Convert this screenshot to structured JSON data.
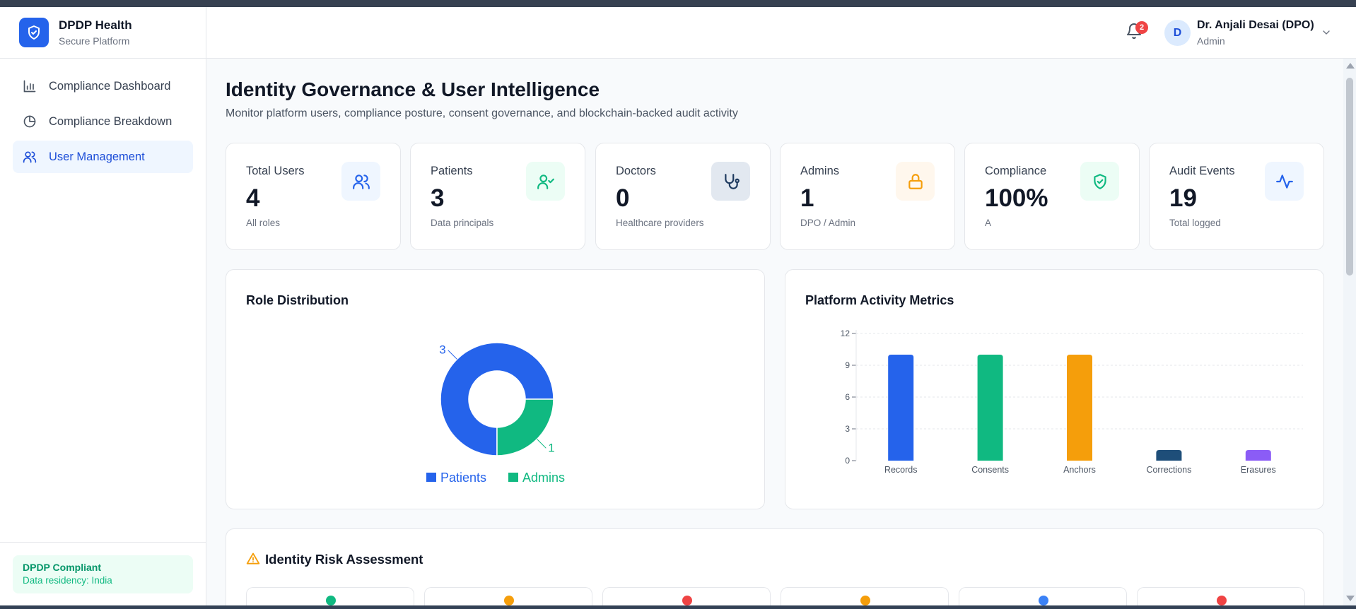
{
  "brand": {
    "title": "DPDP Health",
    "subtitle": "Secure Platform"
  },
  "sidebar": {
    "items": [
      {
        "label": "Compliance Dashboard",
        "icon": "bar-chart-icon",
        "active": false
      },
      {
        "label": "Compliance Breakdown",
        "icon": "pie-chart-icon",
        "active": false
      },
      {
        "label": "User Management",
        "icon": "users-icon",
        "active": true
      }
    ],
    "footer": {
      "title": "DPDP Compliant",
      "subtitle": "Data residency: India"
    }
  },
  "header": {
    "notification_count": "2",
    "avatar_initial": "D",
    "user_name": "Dr. Anjali Desai (DPO)",
    "user_role": "Admin"
  },
  "page": {
    "title": "Identity Governance & User Intelligence",
    "subtitle": "Monitor platform users, compliance posture, consent governance, and blockchain-backed audit activity"
  },
  "stats": [
    {
      "label": "Total Users",
      "value": "4",
      "note": "All roles",
      "icon": "users-icon",
      "color": "#2563eb",
      "bg": "#eff6ff"
    },
    {
      "label": "Patients",
      "value": "3",
      "note": "Data principals",
      "icon": "user-check-icon",
      "color": "#10b981",
      "bg": "#ecfdf5"
    },
    {
      "label": "Doctors",
      "value": "0",
      "note": "Healthcare providers",
      "icon": "stethoscope-icon",
      "color": "#1e3a5f",
      "bg": "#e2e8f0"
    },
    {
      "label": "Admins",
      "value": "1",
      "note": "DPO / Admin",
      "icon": "lock-icon",
      "color": "#f59e0b",
      "bg": "#fff7ed"
    },
    {
      "label": "Compliance",
      "value": "100%",
      "note": "A",
      "icon": "shield-check-icon",
      "color": "#10b981",
      "bg": "#ecfdf5"
    },
    {
      "label": "Audit Events",
      "value": "19",
      "note": "Total logged",
      "icon": "activity-icon",
      "color": "#2563eb",
      "bg": "#eff6ff"
    }
  ],
  "role_card": {
    "title": "Role Distribution"
  },
  "activity_card": {
    "title": "Platform Activity Metrics"
  },
  "risk_card": {
    "title": "Identity Risk Assessment",
    "dot_colors": [
      "#10b981",
      "#f59e0b",
      "#ef4444",
      "#f59e0b",
      "#3b82f6",
      "#ef4444"
    ]
  },
  "chart_data": [
    {
      "type": "pie",
      "title": "Role Distribution",
      "categories": [
        "Patients",
        "Admins"
      ],
      "values": [
        3,
        1
      ],
      "colors": [
        "#2563eb",
        "#10b981"
      ],
      "legend": "bottom"
    },
    {
      "type": "bar",
      "title": "Platform Activity Metrics",
      "categories": [
        "Records",
        "Consents",
        "Anchors",
        "Corrections",
        "Erasures"
      ],
      "values": [
        10,
        10,
        10,
        1,
        1
      ],
      "colors": [
        "#2563eb",
        "#10b981",
        "#f59e0b",
        "#1e4e79",
        "#8b5cf6"
      ],
      "ylim": [
        0,
        12
      ],
      "yticks": [
        0,
        3,
        6,
        9,
        12
      ],
      "grid": true
    }
  ]
}
